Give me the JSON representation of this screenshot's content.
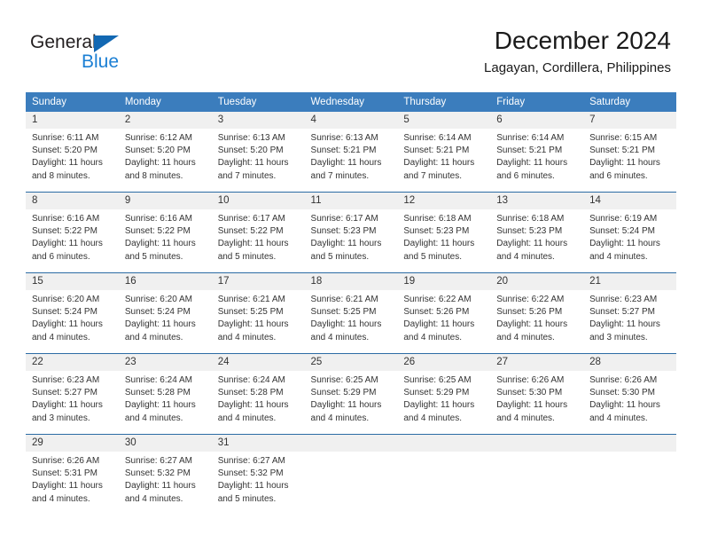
{
  "brand": {
    "name_part1": "General",
    "name_part2": "Blue",
    "logo_icon": "triangle-icon"
  },
  "header": {
    "title": "December 2024",
    "subtitle": "Lagayan, Cordillera, Philippines"
  },
  "colors": {
    "header_blue": "#3b7dbd",
    "rule_blue": "#2c6ca4",
    "daynum_band": "#f0f0f0",
    "brand_blue": "#1b7fd4",
    "text": "#333333"
  },
  "weekdays": [
    "Sunday",
    "Monday",
    "Tuesday",
    "Wednesday",
    "Thursday",
    "Friday",
    "Saturday"
  ],
  "weeks": [
    [
      {
        "day": "1",
        "sunrise": "Sunrise: 6:11 AM",
        "sunset": "Sunset: 5:20 PM",
        "daylight1": "Daylight: 11 hours",
        "daylight2": "and 8 minutes."
      },
      {
        "day": "2",
        "sunrise": "Sunrise: 6:12 AM",
        "sunset": "Sunset: 5:20 PM",
        "daylight1": "Daylight: 11 hours",
        "daylight2": "and 8 minutes."
      },
      {
        "day": "3",
        "sunrise": "Sunrise: 6:13 AM",
        "sunset": "Sunset: 5:20 PM",
        "daylight1": "Daylight: 11 hours",
        "daylight2": "and 7 minutes."
      },
      {
        "day": "4",
        "sunrise": "Sunrise: 6:13 AM",
        "sunset": "Sunset: 5:21 PM",
        "daylight1": "Daylight: 11 hours",
        "daylight2": "and 7 minutes."
      },
      {
        "day": "5",
        "sunrise": "Sunrise: 6:14 AM",
        "sunset": "Sunset: 5:21 PM",
        "daylight1": "Daylight: 11 hours",
        "daylight2": "and 7 minutes."
      },
      {
        "day": "6",
        "sunrise": "Sunrise: 6:14 AM",
        "sunset": "Sunset: 5:21 PM",
        "daylight1": "Daylight: 11 hours",
        "daylight2": "and 6 minutes."
      },
      {
        "day": "7",
        "sunrise": "Sunrise: 6:15 AM",
        "sunset": "Sunset: 5:21 PM",
        "daylight1": "Daylight: 11 hours",
        "daylight2": "and 6 minutes."
      }
    ],
    [
      {
        "day": "8",
        "sunrise": "Sunrise: 6:16 AM",
        "sunset": "Sunset: 5:22 PM",
        "daylight1": "Daylight: 11 hours",
        "daylight2": "and 6 minutes."
      },
      {
        "day": "9",
        "sunrise": "Sunrise: 6:16 AM",
        "sunset": "Sunset: 5:22 PM",
        "daylight1": "Daylight: 11 hours",
        "daylight2": "and 5 minutes."
      },
      {
        "day": "10",
        "sunrise": "Sunrise: 6:17 AM",
        "sunset": "Sunset: 5:22 PM",
        "daylight1": "Daylight: 11 hours",
        "daylight2": "and 5 minutes."
      },
      {
        "day": "11",
        "sunrise": "Sunrise: 6:17 AM",
        "sunset": "Sunset: 5:23 PM",
        "daylight1": "Daylight: 11 hours",
        "daylight2": "and 5 minutes."
      },
      {
        "day": "12",
        "sunrise": "Sunrise: 6:18 AM",
        "sunset": "Sunset: 5:23 PM",
        "daylight1": "Daylight: 11 hours",
        "daylight2": "and 5 minutes."
      },
      {
        "day": "13",
        "sunrise": "Sunrise: 6:18 AM",
        "sunset": "Sunset: 5:23 PM",
        "daylight1": "Daylight: 11 hours",
        "daylight2": "and 4 minutes."
      },
      {
        "day": "14",
        "sunrise": "Sunrise: 6:19 AM",
        "sunset": "Sunset: 5:24 PM",
        "daylight1": "Daylight: 11 hours",
        "daylight2": "and 4 minutes."
      }
    ],
    [
      {
        "day": "15",
        "sunrise": "Sunrise: 6:20 AM",
        "sunset": "Sunset: 5:24 PM",
        "daylight1": "Daylight: 11 hours",
        "daylight2": "and 4 minutes."
      },
      {
        "day": "16",
        "sunrise": "Sunrise: 6:20 AM",
        "sunset": "Sunset: 5:24 PM",
        "daylight1": "Daylight: 11 hours",
        "daylight2": "and 4 minutes."
      },
      {
        "day": "17",
        "sunrise": "Sunrise: 6:21 AM",
        "sunset": "Sunset: 5:25 PM",
        "daylight1": "Daylight: 11 hours",
        "daylight2": "and 4 minutes."
      },
      {
        "day": "18",
        "sunrise": "Sunrise: 6:21 AM",
        "sunset": "Sunset: 5:25 PM",
        "daylight1": "Daylight: 11 hours",
        "daylight2": "and 4 minutes."
      },
      {
        "day": "19",
        "sunrise": "Sunrise: 6:22 AM",
        "sunset": "Sunset: 5:26 PM",
        "daylight1": "Daylight: 11 hours",
        "daylight2": "and 4 minutes."
      },
      {
        "day": "20",
        "sunrise": "Sunrise: 6:22 AM",
        "sunset": "Sunset: 5:26 PM",
        "daylight1": "Daylight: 11 hours",
        "daylight2": "and 4 minutes."
      },
      {
        "day": "21",
        "sunrise": "Sunrise: 6:23 AM",
        "sunset": "Sunset: 5:27 PM",
        "daylight1": "Daylight: 11 hours",
        "daylight2": "and 3 minutes."
      }
    ],
    [
      {
        "day": "22",
        "sunrise": "Sunrise: 6:23 AM",
        "sunset": "Sunset: 5:27 PM",
        "daylight1": "Daylight: 11 hours",
        "daylight2": "and 3 minutes."
      },
      {
        "day": "23",
        "sunrise": "Sunrise: 6:24 AM",
        "sunset": "Sunset: 5:28 PM",
        "daylight1": "Daylight: 11 hours",
        "daylight2": "and 4 minutes."
      },
      {
        "day": "24",
        "sunrise": "Sunrise: 6:24 AM",
        "sunset": "Sunset: 5:28 PM",
        "daylight1": "Daylight: 11 hours",
        "daylight2": "and 4 minutes."
      },
      {
        "day": "25",
        "sunrise": "Sunrise: 6:25 AM",
        "sunset": "Sunset: 5:29 PM",
        "daylight1": "Daylight: 11 hours",
        "daylight2": "and 4 minutes."
      },
      {
        "day": "26",
        "sunrise": "Sunrise: 6:25 AM",
        "sunset": "Sunset: 5:29 PM",
        "daylight1": "Daylight: 11 hours",
        "daylight2": "and 4 minutes."
      },
      {
        "day": "27",
        "sunrise": "Sunrise: 6:26 AM",
        "sunset": "Sunset: 5:30 PM",
        "daylight1": "Daylight: 11 hours",
        "daylight2": "and 4 minutes."
      },
      {
        "day": "28",
        "sunrise": "Sunrise: 6:26 AM",
        "sunset": "Sunset: 5:30 PM",
        "daylight1": "Daylight: 11 hours",
        "daylight2": "and 4 minutes."
      }
    ],
    [
      {
        "day": "29",
        "sunrise": "Sunrise: 6:26 AM",
        "sunset": "Sunset: 5:31 PM",
        "daylight1": "Daylight: 11 hours",
        "daylight2": "and 4 minutes."
      },
      {
        "day": "30",
        "sunrise": "Sunrise: 6:27 AM",
        "sunset": "Sunset: 5:32 PM",
        "daylight1": "Daylight: 11 hours",
        "daylight2": "and 4 minutes."
      },
      {
        "day": "31",
        "sunrise": "Sunrise: 6:27 AM",
        "sunset": "Sunset: 5:32 PM",
        "daylight1": "Daylight: 11 hours",
        "daylight2": "and 5 minutes."
      },
      {
        "day": "",
        "sunrise": "",
        "sunset": "",
        "daylight1": "",
        "daylight2": ""
      },
      {
        "day": "",
        "sunrise": "",
        "sunset": "",
        "daylight1": "",
        "daylight2": ""
      },
      {
        "day": "",
        "sunrise": "",
        "sunset": "",
        "daylight1": "",
        "daylight2": ""
      },
      {
        "day": "",
        "sunrise": "",
        "sunset": "",
        "daylight1": "",
        "daylight2": ""
      }
    ]
  ]
}
